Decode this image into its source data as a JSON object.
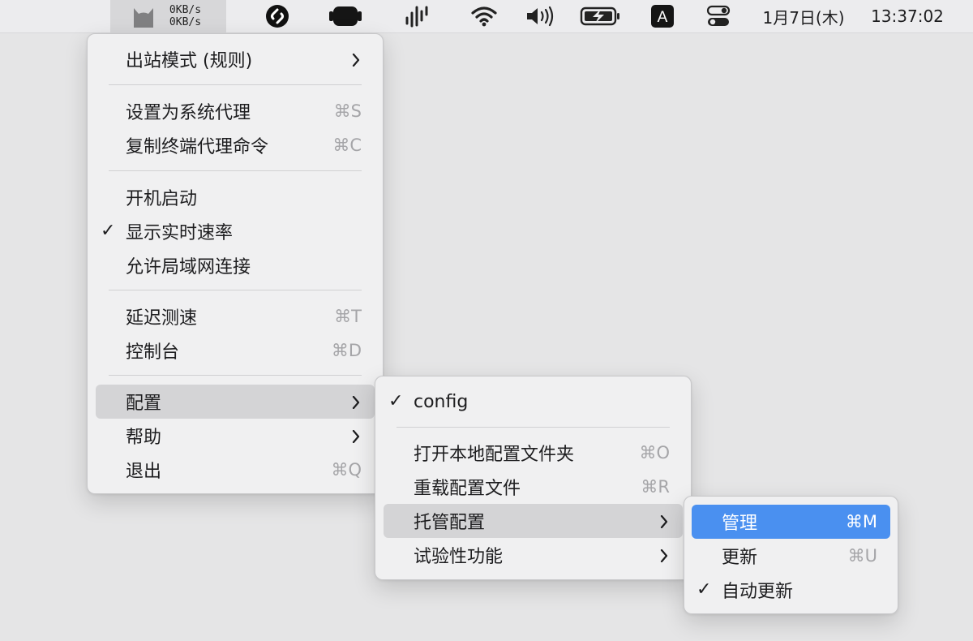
{
  "menubar": {
    "speed_up": "0KB/s",
    "speed_down": "0KB/s",
    "input_source": "A",
    "date": "1月7日(木)",
    "time": "13:37:02"
  },
  "main_menu": {
    "outbound_mode": "出站模式 (规则)",
    "set_system_proxy": "设置为系统代理",
    "set_system_proxy_shortcut": "⌘S",
    "copy_terminal_cmd": "复制终端代理命令",
    "copy_terminal_cmd_shortcut": "⌘C",
    "launch_at_login": "开机启动",
    "show_speed_check": "✓",
    "show_speed": "显示实时速率",
    "allow_lan": "允许局域网连接",
    "latency_test": "延迟测速",
    "latency_test_shortcut": "⌘T",
    "dashboard": "控制台",
    "dashboard_shortcut": "⌘D",
    "config": "配置",
    "help": "帮助",
    "quit": "退出",
    "quit_shortcut": "⌘Q"
  },
  "config_menu": {
    "config_check": "✓",
    "config_name": "config",
    "open_local_folder": "打开本地配置文件夹",
    "open_local_folder_shortcut": "⌘O",
    "reload_config": "重载配置文件",
    "reload_config_shortcut": "⌘R",
    "hosted_config": "托管配置",
    "experimental": "试验性功能"
  },
  "hosted_menu": {
    "manage": "管理",
    "manage_shortcut": "⌘M",
    "update": "更新",
    "update_shortcut": "⌘U",
    "auto_update_check": "✓",
    "auto_update": "自动更新"
  },
  "icons": [
    "cat-app-icon",
    "shazam-icon",
    "battery-case-icon",
    "audio-waveform-icon",
    "wifi-icon",
    "volume-icon",
    "battery-charging-icon",
    "input-source-icon",
    "control-center-icon",
    "chevron-right-icon"
  ],
  "colors": {
    "selection": "#4a90f0",
    "highlight": "#d4d4d6",
    "menu_bg": "#f0f0f1",
    "shortcut_text": "#a5a5a8"
  }
}
